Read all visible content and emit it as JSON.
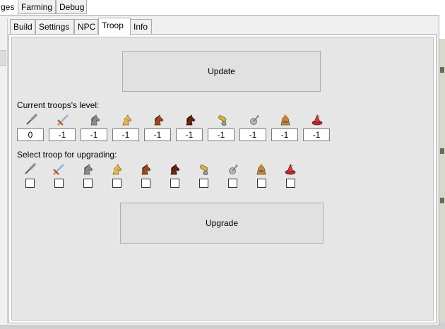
{
  "top_tabs": [
    {
      "label": "ges",
      "active": true
    },
    {
      "label": "Farming",
      "active": false
    },
    {
      "label": "Debug",
      "active": false
    }
  ],
  "inner_tabs": [
    {
      "label": "Build",
      "active": false
    },
    {
      "label": "Settings",
      "active": false
    },
    {
      "label": "NPC",
      "active": false
    },
    {
      "label": "Troop",
      "active": true
    },
    {
      "label": "Info",
      "active": false
    }
  ],
  "update_button": {
    "label": "Update"
  },
  "current_levels": {
    "label": "Current troops's level:",
    "values": [
      "0",
      "-1",
      "-1",
      "-1",
      "-1",
      "-1",
      "-1",
      "-1",
      "-1",
      "-1"
    ]
  },
  "upgrade_select": {
    "label": "Select troop for upgrading:",
    "checked": [
      false,
      false,
      false,
      false,
      false,
      false,
      false,
      false,
      false,
      false
    ]
  },
  "upgrade_button": {
    "label": "Upgrade"
  },
  "troop_icons": [
    "club-icon",
    "sword-icon",
    "grey-horse-icon",
    "tan-horse-icon",
    "brown-horse-icon",
    "dark-horse-icon",
    "ram-icon",
    "catapult-icon",
    "chief-icon",
    "settler-icon"
  ]
}
